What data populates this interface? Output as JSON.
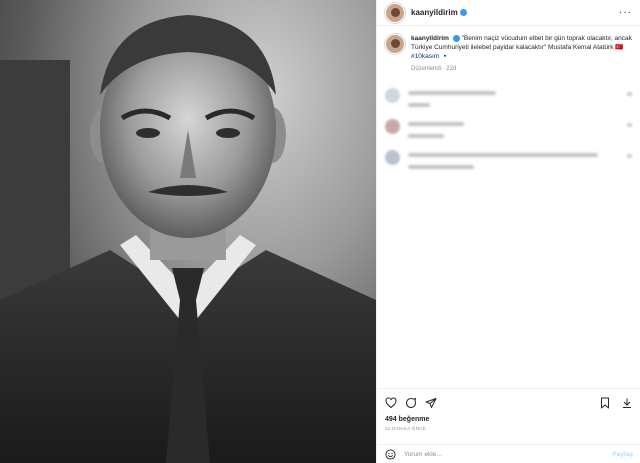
{
  "header": {
    "username": "kaanyildirim",
    "more_icon": "more-horizontal-icon"
  },
  "caption": {
    "username": "kaanyildirim",
    "text": "\"Benim naçiz vücudum elbet bir gün toprak olacaktır, ancak Türkiye Cumhuriyeti ilelebet payidar kalacaktır\" Mustafa Kemal Atatürk ",
    "hashtag": "#10kasım",
    "meta": "Düzenlendi · 22d"
  },
  "actions": {
    "likes": "494 beğenme",
    "time": "21 DAKIKA ÖNCE"
  },
  "add_comment": {
    "placeholder": "Yorum ekle...",
    "share_label": "Paylaş"
  }
}
